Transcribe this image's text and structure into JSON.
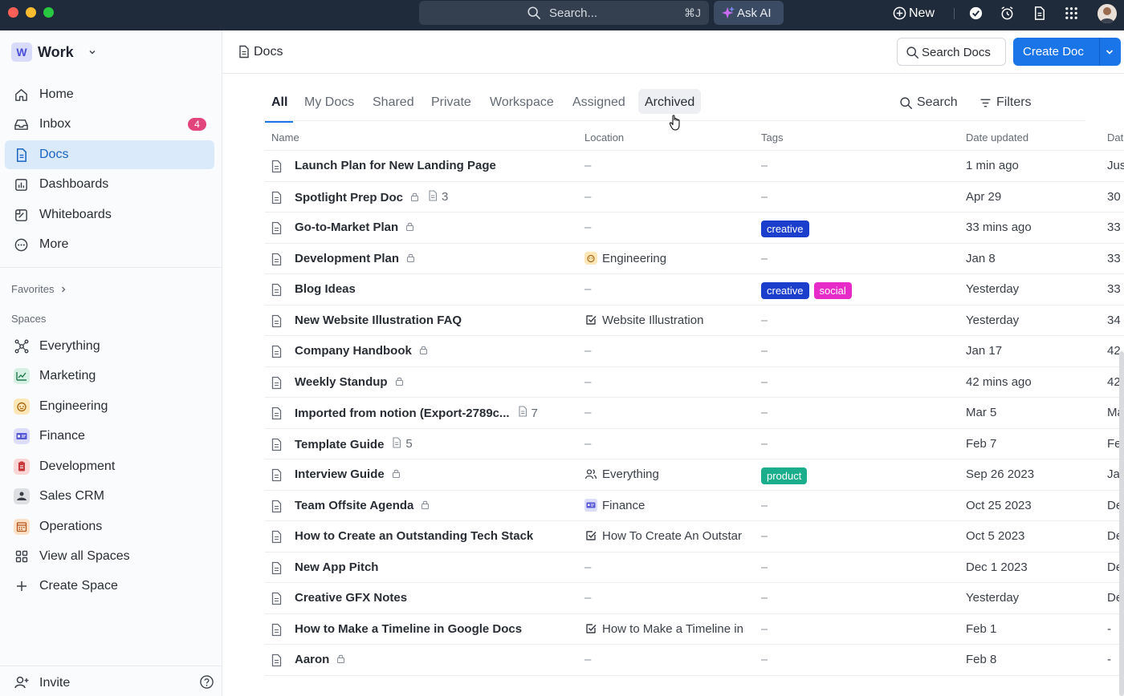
{
  "topbar": {
    "search_placeholder": "Search...",
    "search_shortcut": "⌘J",
    "ask_ai": "Ask AI",
    "new_label": "New"
  },
  "sidebar": {
    "workspace_initial": "W",
    "workspace_name": "Work",
    "nav": [
      {
        "label": "Home",
        "icon": "home-icon"
      },
      {
        "label": "Inbox",
        "icon": "inbox-icon",
        "badge": "4"
      },
      {
        "label": "Docs",
        "icon": "docs-icon",
        "active": true
      },
      {
        "label": "Dashboards",
        "icon": "dashboard-icon"
      },
      {
        "label": "Whiteboards",
        "icon": "whiteboard-icon"
      },
      {
        "label": "More",
        "icon": "more-icon"
      }
    ],
    "favorites_label": "Favorites",
    "spaces_label": "Spaces",
    "spaces": [
      {
        "label": "Everything",
        "color": "#ffffff"
      },
      {
        "label": "Marketing",
        "color": "#d6f1e3"
      },
      {
        "label": "Engineering",
        "color": "#fde7b8"
      },
      {
        "label": "Finance",
        "color": "#dcdcfb"
      },
      {
        "label": "Development",
        "color": "#fbd6d6"
      },
      {
        "label": "Sales CRM",
        "color": "#dddfe3"
      },
      {
        "label": "Operations",
        "color": "#fde0c8"
      },
      {
        "label": "View all Spaces",
        "color": "#ffffff"
      },
      {
        "label": "Create Space",
        "color": "#ffffff"
      }
    ],
    "invite_label": "Invite"
  },
  "header": {
    "breadcrumb": "Docs",
    "search_docs": "Search Docs",
    "create_doc": "Create Doc"
  },
  "tabs": [
    {
      "label": "All",
      "active": true
    },
    {
      "label": "My Docs"
    },
    {
      "label": "Shared"
    },
    {
      "label": "Private"
    },
    {
      "label": "Workspace"
    },
    {
      "label": "Assigned"
    },
    {
      "label": "Archived",
      "hover": true
    }
  ],
  "tools": {
    "search": "Search",
    "filters": "Filters"
  },
  "columns": [
    "Name",
    "Location",
    "Tags",
    "Date updated",
    "Dat"
  ],
  "colors": {
    "accent": "#1a75e8",
    "tag_creative": "#1b3fcc",
    "tag_social": "#e62bc9",
    "tag_product": "#1bae8c"
  },
  "rows": [
    {
      "name": "Launch Plan for New Landing Page",
      "lock": false,
      "count": "",
      "location": "–",
      "loc_icon": "",
      "tags": [],
      "updated": "1 min ago",
      "created": "Jus"
    },
    {
      "name": "Spotlight Prep Doc",
      "lock": true,
      "count": "3",
      "location": "–",
      "loc_icon": "",
      "tags": [],
      "updated": "Apr 29",
      "created": "30"
    },
    {
      "name": "Go-to-Market Plan",
      "lock": true,
      "count": "",
      "location": "–",
      "loc_icon": "",
      "tags": [
        {
          "label": "creative",
          "color": "#1b3fcc"
        }
      ],
      "updated": "33 mins ago",
      "created": "33"
    },
    {
      "name": "Development Plan",
      "lock": true,
      "count": "",
      "location": "Engineering",
      "loc_icon": "engineering",
      "tags": [],
      "updated": "Jan 8",
      "created": "33"
    },
    {
      "name": "Blog Ideas",
      "lock": false,
      "count": "",
      "location": "–",
      "loc_icon": "",
      "tags": [
        {
          "label": "creative",
          "color": "#1b3fcc"
        },
        {
          "label": "social",
          "color": "#e62bc9"
        }
      ],
      "updated": "Yesterday",
      "created": "33"
    },
    {
      "name": "New Website Illustration FAQ",
      "lock": false,
      "count": "",
      "location": "Website Illustration",
      "loc_icon": "task",
      "tags": [],
      "updated": "Yesterday",
      "created": "34"
    },
    {
      "name": "Company Handbook",
      "lock": true,
      "count": "",
      "location": "–",
      "loc_icon": "",
      "tags": [],
      "updated": "Jan 17",
      "created": "42"
    },
    {
      "name": "Weekly Standup",
      "lock": true,
      "count": "",
      "location": "–",
      "loc_icon": "",
      "tags": [],
      "updated": "42 mins ago",
      "created": "42"
    },
    {
      "name": "Imported from notion (Export-2789c...",
      "lock": false,
      "count": "7",
      "location": "–",
      "loc_icon": "",
      "tags": [],
      "updated": "Mar 5",
      "created": "Ma"
    },
    {
      "name": "Template Guide",
      "lock": false,
      "count": "5",
      "location": "–",
      "loc_icon": "",
      "tags": [],
      "updated": "Feb 7",
      "created": "Fel"
    },
    {
      "name": "Interview Guide",
      "lock": true,
      "count": "",
      "location": "Everything",
      "loc_icon": "people",
      "tags": [
        {
          "label": "product",
          "color": "#1bae8c"
        }
      ],
      "updated": "Sep 26 2023",
      "created": "Jar"
    },
    {
      "name": "Team Offsite Agenda",
      "lock": true,
      "count": "",
      "location": "Finance",
      "loc_icon": "finance",
      "tags": [],
      "updated": "Oct 25 2023",
      "created": "De"
    },
    {
      "name": "How to Create an Outstanding Tech Stack",
      "lock": false,
      "count": "",
      "location": "How To Create An Outstar",
      "loc_icon": "task",
      "tags": [],
      "updated": "Oct 5 2023",
      "created": "De"
    },
    {
      "name": "New App Pitch",
      "lock": false,
      "count": "",
      "location": "–",
      "loc_icon": "",
      "tags": [],
      "updated": "Dec 1 2023",
      "created": "De"
    },
    {
      "name": "Creative GFX Notes",
      "lock": false,
      "count": "",
      "location": "–",
      "loc_icon": "",
      "tags": [],
      "updated": "Yesterday",
      "created": "De"
    },
    {
      "name": "How to Make a Timeline in Google Docs",
      "lock": false,
      "count": "",
      "location": "How to Make a Timeline in",
      "loc_icon": "task",
      "tags": [],
      "updated": "Feb 1",
      "created": "-"
    },
    {
      "name": "Aaron",
      "lock": true,
      "count": "",
      "location": "–",
      "loc_icon": "",
      "tags": [],
      "updated": "Feb 8",
      "created": "-"
    }
  ]
}
